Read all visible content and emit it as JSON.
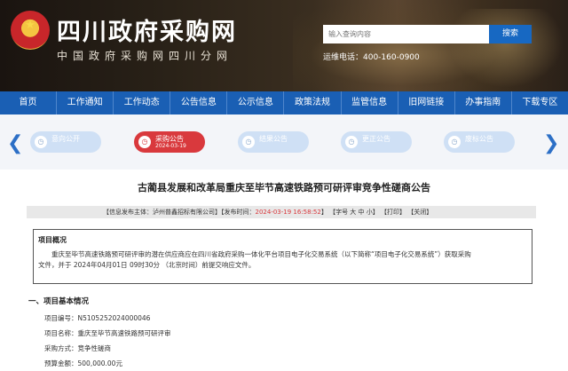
{
  "header": {
    "site_title": "四川政府采购网",
    "site_subtitle": "中国政府采购网四川分网",
    "search_placeholder": "输入查询内容",
    "search_button": "搜索",
    "hotline": "运维电话：400-160-0900"
  },
  "nav": {
    "items": [
      "首页",
      "工作通知",
      "工作动态",
      "公告信息",
      "公示信息",
      "政策法规",
      "监管信息",
      "旧网链接",
      "办事指南",
      "下载专区"
    ]
  },
  "steps": {
    "items": [
      {
        "label": "意向公开",
        "date": "",
        "active": false
      },
      {
        "label": "采购公告",
        "date": "2024-03-19",
        "active": true
      },
      {
        "label": "结果公告",
        "date": "",
        "active": false
      },
      {
        "label": "更正公告",
        "date": "",
        "active": false
      },
      {
        "label": "废标公告",
        "date": "",
        "active": false
      }
    ]
  },
  "notice": {
    "title": "古蔺县发展和改革局重庆至毕节高速铁路预可研评审竞争性磋商公告",
    "info_prefix": "【信息发布主体：泸州普鑫招标有限公司】【发布时间：",
    "publish_time": "2024-03-19 16:58:52",
    "info_suffix": "】  【字号 大 中 小】 【打印】 【关闭】"
  },
  "overview": {
    "heading": "项目概况",
    "line1": "重庆至毕节高速铁路预可研评审的潜在供应商应在四川省政府采购一体化平台项目电子化交易系统（以下简称“项目电子化交易系统”）获取采购",
    "line2": "文件，并于 2024年04月01日 09时30分 （北京时间）前提交响应文件。"
  },
  "section": {
    "title": "一、项目基本情况",
    "rows": [
      {
        "label": "项目编号：",
        "value": "N5105252024000046"
      },
      {
        "label": "项目名称：",
        "value": "重庆至毕节高速铁路预可研评审"
      },
      {
        "label": "采购方式：",
        "value": "竞争性磋商"
      },
      {
        "label": "预算金额：",
        "value": "500,000.00元"
      }
    ]
  },
  "colors": {
    "nav": "#1a5fb4",
    "active_step": "#d9393d",
    "step": "#cfe0f5"
  }
}
